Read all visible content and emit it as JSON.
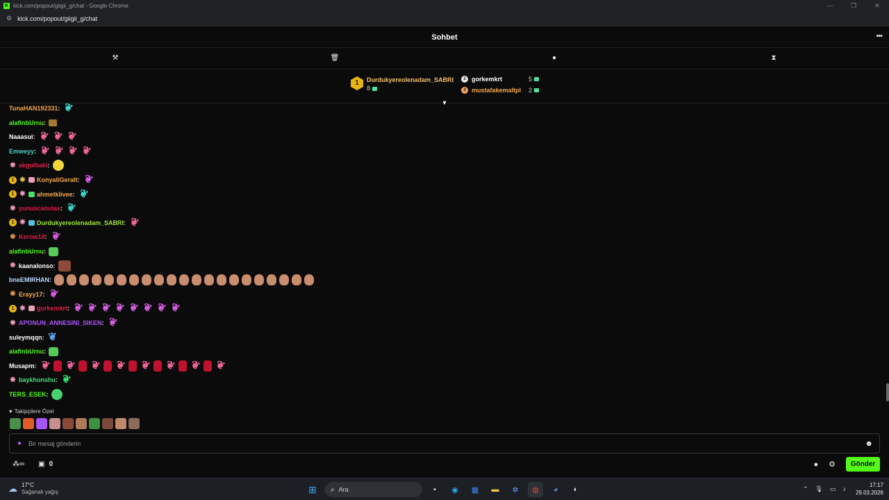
{
  "browser": {
    "window_title": "kick.com/popout/giigii_g/chat - Google Chrome",
    "url": "kick.com/popout/giigii_g/chat",
    "favicon_letter": "K"
  },
  "chat": {
    "title": "Sohbet",
    "more_icon": "more-icon",
    "tools": [
      "pin-icon",
      "trash-icon",
      "chat-bubble-icon",
      "hourglass-icon"
    ]
  },
  "leaderboard": {
    "first": {
      "rank": "1",
      "name": "Durdukyereolenadam_SABRI",
      "count": "8"
    },
    "second": {
      "name": "gorkemkrt",
      "count": "5"
    },
    "third": {
      "name": "mustafakemaltpl",
      "count": "2"
    }
  },
  "messages": [
    {
      "user": "TunaHAN192331",
      "color": "#f6a84a",
      "badges": [],
      "emotes": [
        "feather-c"
      ]
    },
    {
      "user": "alafinbUrnu",
      "color": "#53fc18",
      "badges": [],
      "emotes": [
        "box"
      ]
    },
    {
      "user": "Naaasui",
      "color": "#ffffff",
      "badges": [],
      "emotes": [
        "feather",
        "feather",
        "feather"
      ]
    },
    {
      "user": "Emweyy",
      "color": "#4fd1c5",
      "badges": [],
      "emotes": [
        "feather",
        "feather",
        "feather",
        "feather"
      ]
    },
    {
      "user": "akgulbaki",
      "color": "#e11d48",
      "badges": [
        "bfly"
      ],
      "emotes": [
        "yellow"
      ]
    },
    {
      "user": "KonyaliGeralt",
      "color": "#f6a84a",
      "badges": [
        "gold",
        "bfly-y",
        "giftb"
      ],
      "emotes": [
        "feather-p"
      ]
    },
    {
      "user": "ahmetklivee",
      "color": "#f6a84a",
      "badges": [
        "gold",
        "bfly",
        "giftg"
      ],
      "emotes": [
        "feather-c"
      ]
    },
    {
      "user": "yunuscanulas",
      "color": "#e11d48",
      "badges": [
        "bfly"
      ],
      "emotes": [
        "feather-c"
      ]
    },
    {
      "user": "Durdukyereolenadam_SABRI",
      "color": "#a3e635",
      "badges": [
        "gold",
        "bfly",
        "giftt"
      ],
      "emotes": [
        "feather"
      ]
    },
    {
      "user": "Kerow18",
      "color": "#e11d48",
      "badges": [
        "bfly-o"
      ],
      "emotes": [
        "feather-p"
      ]
    },
    {
      "user": "alafinbUrnu",
      "color": "#53fc18",
      "badges": [],
      "emotes": [
        "green"
      ]
    },
    {
      "user": "kaanalonso",
      "color": "#ffffff",
      "badges": [
        "bfly"
      ],
      "emotes": [
        "photo"
      ]
    },
    {
      "user": "bneEMIRHAN",
      "color": "#bfdbfe",
      "badges": [],
      "emotes": [
        "face",
        "face",
        "face",
        "face",
        "face",
        "face",
        "face",
        "face",
        "face",
        "face",
        "face",
        "face",
        "face",
        "face",
        "face",
        "face",
        "face",
        "face",
        "face",
        "face",
        "face"
      ]
    },
    {
      "user": "Erayy17",
      "color": "#f6a84a",
      "badges": [
        "bfly-o"
      ],
      "emotes": [
        "feather-p"
      ]
    },
    {
      "user": "gorkemkrt",
      "color": "#e11d48",
      "badges": [
        "gold",
        "bfly",
        "giftb"
      ],
      "emotes": [
        "feather-p",
        "feather-p",
        "feather-p",
        "feather-p",
        "feather-p",
        "feather-p",
        "feather-p",
        "feather-p"
      ]
    },
    {
      "user": "APONUN_ANNESINI_SIKEN",
      "color": "#a855f7",
      "badges": [
        "bfly"
      ],
      "emotes": [
        "feather-p"
      ]
    },
    {
      "user": "suleymqqn",
      "color": "#ffffff",
      "badges": [],
      "emotes": [
        "feather-b"
      ]
    },
    {
      "user": "alafinbUrnu",
      "color": "#53fc18",
      "badges": [],
      "emotes": [
        "green"
      ]
    },
    {
      "user": "Musapm",
      "color": "#ffffff",
      "badges": [],
      "emotes": [
        "feather",
        "red",
        "feather",
        "red",
        "feather",
        "red",
        "feather",
        "red",
        "feather",
        "red",
        "feather",
        "red",
        "feather",
        "red",
        "feather"
      ]
    },
    {
      "user": "baykhonshu",
      "color": "#4ade80",
      "badges": [
        "bfly"
      ],
      "emotes": [
        "feather-g"
      ]
    },
    {
      "user": "TERS_ESEK",
      "color": "#53fc18",
      "badges": [],
      "emotes": [
        "frog"
      ]
    }
  ],
  "followers_only": {
    "label": "Takipçilere Özel",
    "emote_colors": [
      "#4a8f4a",
      "#e05b2a",
      "#a855f7",
      "#c98e8e",
      "#8a4a3a",
      "#b07a5a",
      "#3f8f3f",
      "#7a4a3a",
      "#c08a6a",
      "#8a6a5a"
    ]
  },
  "input": {
    "placeholder": "Bir mesaj gönderin"
  },
  "bottom": {
    "points": "0",
    "send_label": "Gönder"
  },
  "taskbar": {
    "temperature": "17°C",
    "condition": "Sağanak yağış",
    "search_label": "Ara",
    "time": "17:17",
    "date": "29.03.2026"
  },
  "colors": {
    "accent": "#53fc18",
    "background": "#0b0b0c"
  }
}
